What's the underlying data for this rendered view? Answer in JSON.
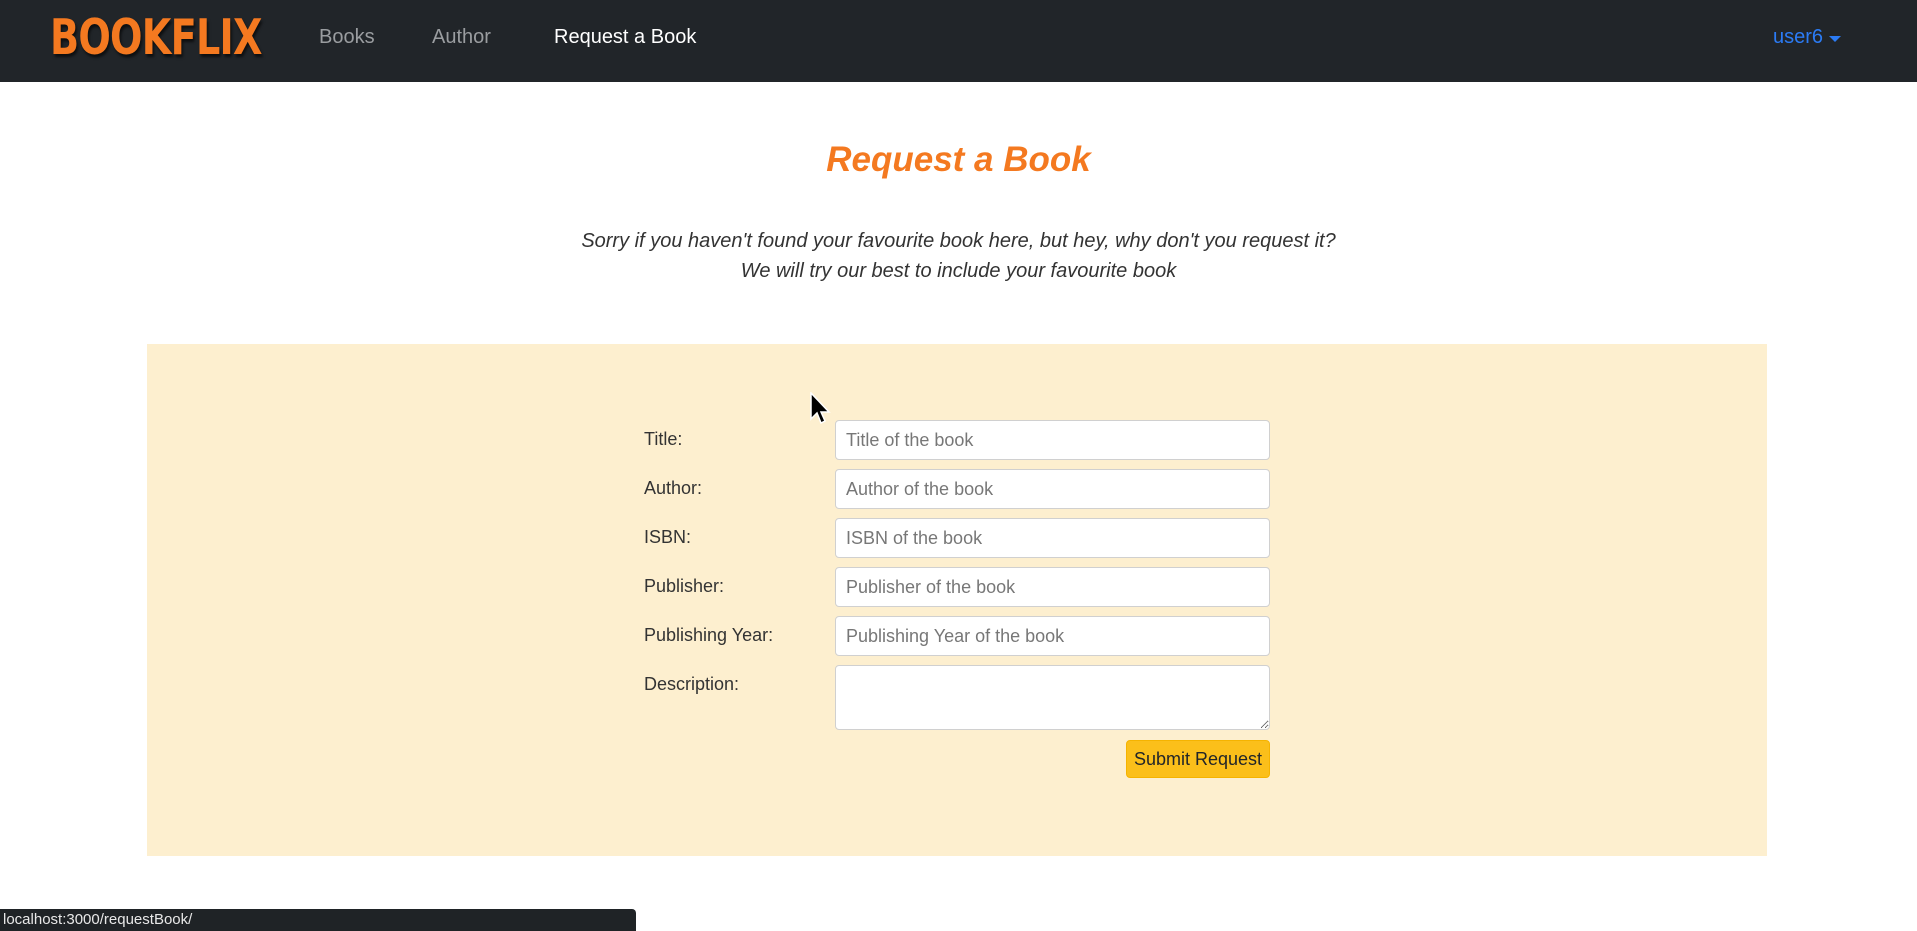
{
  "navbar": {
    "brand": "BOOKFLIX",
    "links": [
      {
        "label": "Books"
      },
      {
        "label": "Author"
      },
      {
        "label": "Request a Book"
      }
    ],
    "user": "user6"
  },
  "page": {
    "heading": "Request a Book",
    "subtitle_line1": "Sorry if you haven't found your favourite book here, but hey, why don't you request it?",
    "subtitle_line2": "We will try our best to include your favourite book"
  },
  "form": {
    "fields": [
      {
        "label": "Title:",
        "placeholder": "Title of the book",
        "value": ""
      },
      {
        "label": "Author:",
        "placeholder": "Author of the book",
        "value": ""
      },
      {
        "label": "ISBN:",
        "placeholder": "ISBN of the book",
        "value": ""
      },
      {
        "label": "Publisher:",
        "placeholder": "Publisher of the book",
        "value": ""
      },
      {
        "label": "Publishing Year:",
        "placeholder": "Publishing Year of the book",
        "value": ""
      },
      {
        "label": "Description:",
        "placeholder": "",
        "value": ""
      }
    ],
    "submit_label": "Submit Request"
  },
  "status_bar": {
    "url": "localhost:3000/requestBook/"
  },
  "colors": {
    "navbar_bg": "#212529",
    "brand": "#f47920",
    "heading": "#f47920",
    "panel_bg": "#fdefcf",
    "submit_bg": "#fbbf1a",
    "user_link": "#2b7bf4"
  }
}
